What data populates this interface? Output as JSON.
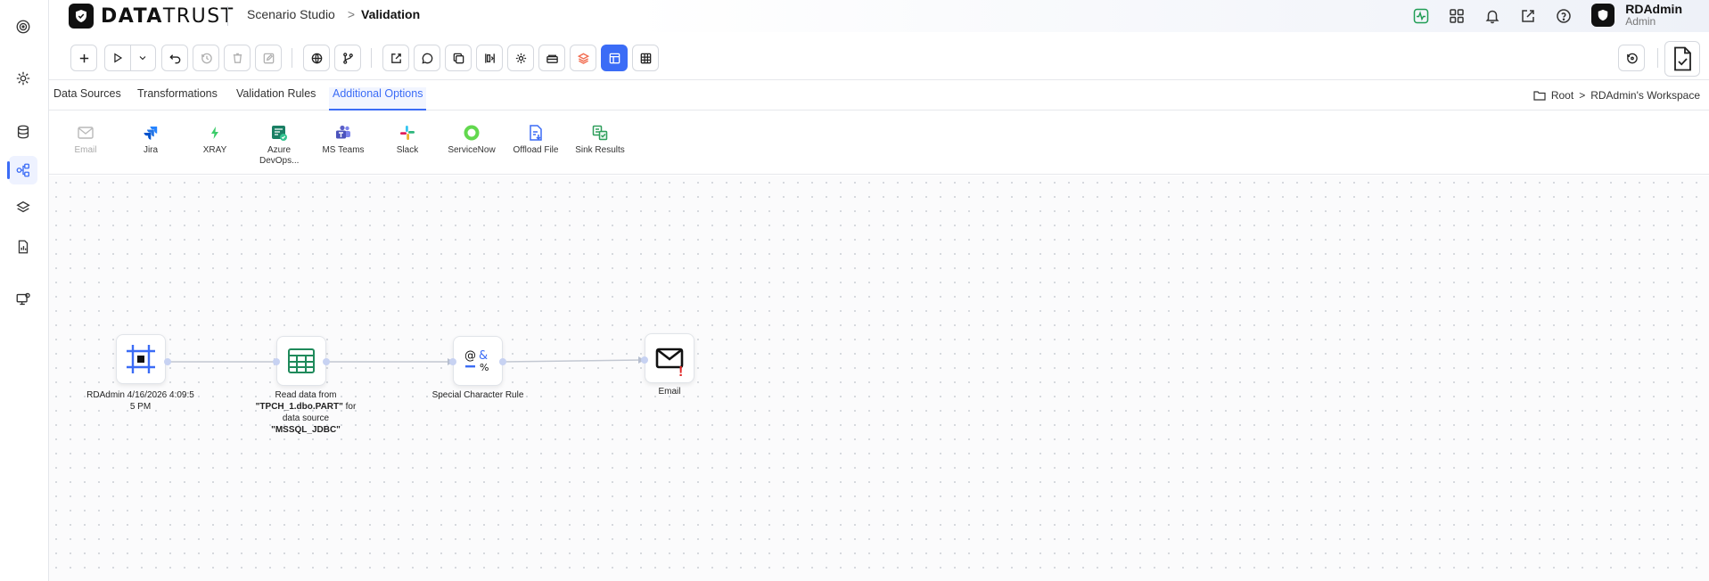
{
  "app": {
    "logo_text_left": "DATA",
    "logo_text_right": "TRUST",
    "breadcrumb_root": "Scenario Studio",
    "breadcrumb_sep": ">",
    "breadcrumb_current": "Validation"
  },
  "user": {
    "name": "RDAdmin",
    "role": "Admin"
  },
  "tabs": [
    {
      "label": "Data Sources"
    },
    {
      "label": "Transformations"
    },
    {
      "label": "Validation Rules"
    },
    {
      "label": "Additional Options",
      "active": true
    }
  ],
  "workspace": {
    "root": "Root",
    "sep": ">",
    "name": "RDAdmin's Workspace"
  },
  "options": [
    {
      "label": "Email",
      "icon": "mail-icon",
      "disabled": true
    },
    {
      "label": "Jira",
      "icon": "jira-icon"
    },
    {
      "label": "XRAY",
      "icon": "xray-icon"
    },
    {
      "label": "Azure DevOps...",
      "icon": "azure-devops-icon"
    },
    {
      "label": "MS Teams",
      "icon": "ms-teams-icon"
    },
    {
      "label": "Slack",
      "icon": "slack-icon"
    },
    {
      "label": "ServiceNow",
      "icon": "servicenow-icon"
    },
    {
      "label": "Offload File",
      "icon": "offload-file-icon"
    },
    {
      "label": "Sink Results",
      "icon": "sink-results-icon"
    }
  ],
  "nodes": [
    {
      "id": "start",
      "icon": "frame-start-icon",
      "label": "RDAdmin 4/16/2026 4:09:5 5 PM"
    },
    {
      "id": "read",
      "icon": "table-icon",
      "label_prefix": "Read data from ",
      "label_bold_1": "\"TPCH_1.dbo.PART\"",
      "label_mid": " for data source ",
      "label_bold_2": "\"MSSQL_JDBC\""
    },
    {
      "id": "rule",
      "icon": "special-character-icon",
      "label": "Special Character Rule"
    },
    {
      "id": "email",
      "icon": "envelope-icon",
      "label": "Email",
      "warning": "!"
    }
  ],
  "colors": {
    "accent": "#3b6cf6",
    "warning": "#e02424",
    "jira": "#2684ff",
    "teams": "#5b5fc7",
    "servicenow": "#62d84e",
    "sink": "#2e9e5b"
  }
}
